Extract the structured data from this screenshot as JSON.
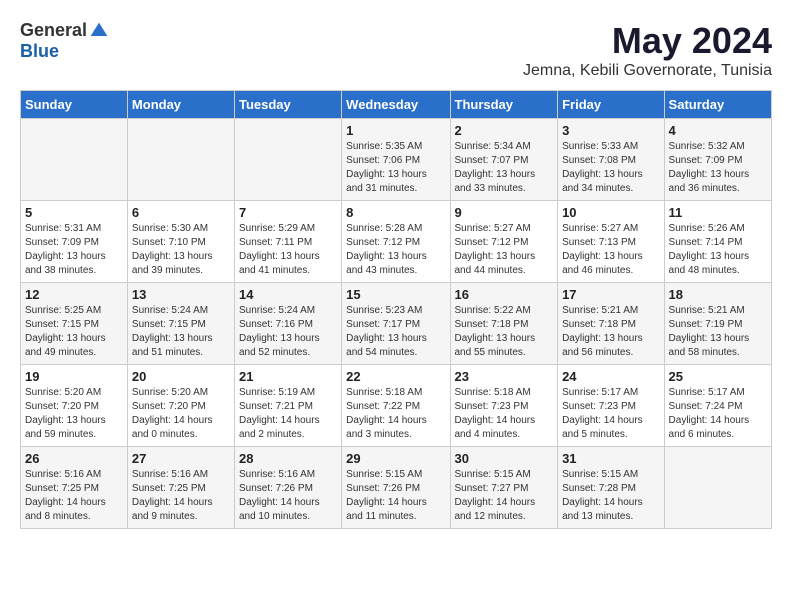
{
  "logo": {
    "general": "General",
    "blue": "Blue"
  },
  "title": "May 2024",
  "location": "Jemna, Kebili Governorate, Tunisia",
  "weekdays": [
    "Sunday",
    "Monday",
    "Tuesday",
    "Wednesday",
    "Thursday",
    "Friday",
    "Saturday"
  ],
  "weeks": [
    [
      {
        "day": "",
        "content": ""
      },
      {
        "day": "",
        "content": ""
      },
      {
        "day": "",
        "content": ""
      },
      {
        "day": "1",
        "content": "Sunrise: 5:35 AM\nSunset: 7:06 PM\nDaylight: 13 hours\nand 31 minutes."
      },
      {
        "day": "2",
        "content": "Sunrise: 5:34 AM\nSunset: 7:07 PM\nDaylight: 13 hours\nand 33 minutes."
      },
      {
        "day": "3",
        "content": "Sunrise: 5:33 AM\nSunset: 7:08 PM\nDaylight: 13 hours\nand 34 minutes."
      },
      {
        "day": "4",
        "content": "Sunrise: 5:32 AM\nSunset: 7:09 PM\nDaylight: 13 hours\nand 36 minutes."
      }
    ],
    [
      {
        "day": "5",
        "content": "Sunrise: 5:31 AM\nSunset: 7:09 PM\nDaylight: 13 hours\nand 38 minutes."
      },
      {
        "day": "6",
        "content": "Sunrise: 5:30 AM\nSunset: 7:10 PM\nDaylight: 13 hours\nand 39 minutes."
      },
      {
        "day": "7",
        "content": "Sunrise: 5:29 AM\nSunset: 7:11 PM\nDaylight: 13 hours\nand 41 minutes."
      },
      {
        "day": "8",
        "content": "Sunrise: 5:28 AM\nSunset: 7:12 PM\nDaylight: 13 hours\nand 43 minutes."
      },
      {
        "day": "9",
        "content": "Sunrise: 5:27 AM\nSunset: 7:12 PM\nDaylight: 13 hours\nand 44 minutes."
      },
      {
        "day": "10",
        "content": "Sunrise: 5:27 AM\nSunset: 7:13 PM\nDaylight: 13 hours\nand 46 minutes."
      },
      {
        "day": "11",
        "content": "Sunrise: 5:26 AM\nSunset: 7:14 PM\nDaylight: 13 hours\nand 48 minutes."
      }
    ],
    [
      {
        "day": "12",
        "content": "Sunrise: 5:25 AM\nSunset: 7:15 PM\nDaylight: 13 hours\nand 49 minutes."
      },
      {
        "day": "13",
        "content": "Sunrise: 5:24 AM\nSunset: 7:15 PM\nDaylight: 13 hours\nand 51 minutes."
      },
      {
        "day": "14",
        "content": "Sunrise: 5:24 AM\nSunset: 7:16 PM\nDaylight: 13 hours\nand 52 minutes."
      },
      {
        "day": "15",
        "content": "Sunrise: 5:23 AM\nSunset: 7:17 PM\nDaylight: 13 hours\nand 54 minutes."
      },
      {
        "day": "16",
        "content": "Sunrise: 5:22 AM\nSunset: 7:18 PM\nDaylight: 13 hours\nand 55 minutes."
      },
      {
        "day": "17",
        "content": "Sunrise: 5:21 AM\nSunset: 7:18 PM\nDaylight: 13 hours\nand 56 minutes."
      },
      {
        "day": "18",
        "content": "Sunrise: 5:21 AM\nSunset: 7:19 PM\nDaylight: 13 hours\nand 58 minutes."
      }
    ],
    [
      {
        "day": "19",
        "content": "Sunrise: 5:20 AM\nSunset: 7:20 PM\nDaylight: 13 hours\nand 59 minutes."
      },
      {
        "day": "20",
        "content": "Sunrise: 5:20 AM\nSunset: 7:20 PM\nDaylight: 14 hours\nand 0 minutes."
      },
      {
        "day": "21",
        "content": "Sunrise: 5:19 AM\nSunset: 7:21 PM\nDaylight: 14 hours\nand 2 minutes."
      },
      {
        "day": "22",
        "content": "Sunrise: 5:18 AM\nSunset: 7:22 PM\nDaylight: 14 hours\nand 3 minutes."
      },
      {
        "day": "23",
        "content": "Sunrise: 5:18 AM\nSunset: 7:23 PM\nDaylight: 14 hours\nand 4 minutes."
      },
      {
        "day": "24",
        "content": "Sunrise: 5:17 AM\nSunset: 7:23 PM\nDaylight: 14 hours\nand 5 minutes."
      },
      {
        "day": "25",
        "content": "Sunrise: 5:17 AM\nSunset: 7:24 PM\nDaylight: 14 hours\nand 6 minutes."
      }
    ],
    [
      {
        "day": "26",
        "content": "Sunrise: 5:16 AM\nSunset: 7:25 PM\nDaylight: 14 hours\nand 8 minutes."
      },
      {
        "day": "27",
        "content": "Sunrise: 5:16 AM\nSunset: 7:25 PM\nDaylight: 14 hours\nand 9 minutes."
      },
      {
        "day": "28",
        "content": "Sunrise: 5:16 AM\nSunset: 7:26 PM\nDaylight: 14 hours\nand 10 minutes."
      },
      {
        "day": "29",
        "content": "Sunrise: 5:15 AM\nSunset: 7:26 PM\nDaylight: 14 hours\nand 11 minutes."
      },
      {
        "day": "30",
        "content": "Sunrise: 5:15 AM\nSunset: 7:27 PM\nDaylight: 14 hours\nand 12 minutes."
      },
      {
        "day": "31",
        "content": "Sunrise: 5:15 AM\nSunset: 7:28 PM\nDaylight: 14 hours\nand 13 minutes."
      },
      {
        "day": "",
        "content": ""
      }
    ]
  ]
}
